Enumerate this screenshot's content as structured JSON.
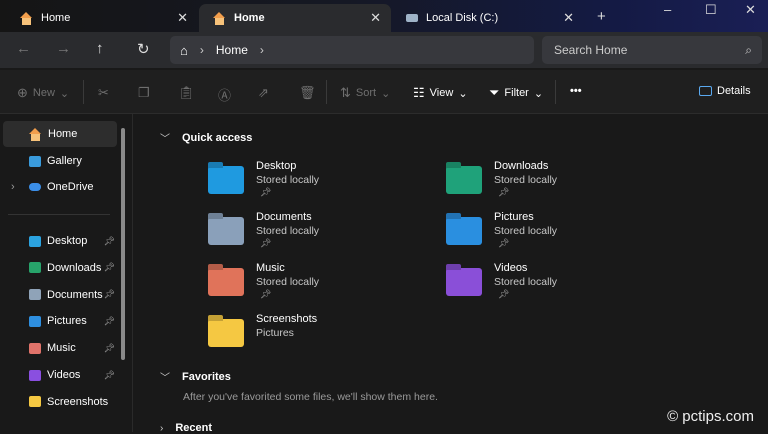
{
  "tabs": [
    {
      "label": "Home",
      "active": false
    },
    {
      "label": "Home",
      "active": true
    },
    {
      "label": "Local Disk (C:)",
      "active": false
    }
  ],
  "window_controls": {
    "new_tab": "+",
    "minimize": "–",
    "maximize": "☐",
    "close": "✕"
  },
  "address": {
    "segments": [
      "Home"
    ],
    "search_placeholder": "Search Home"
  },
  "toolbar": {
    "new": "New",
    "sort": "Sort",
    "view": "View",
    "filter": "Filter",
    "more": "•••",
    "details": "Details"
  },
  "sidebar": {
    "items": [
      {
        "label": "Home",
        "icon": "home-icon",
        "color": "#f29e4c",
        "selected": true
      },
      {
        "label": "Gallery",
        "icon": "gallery-icon",
        "color": "#3a9bdc"
      },
      {
        "label": "OneDrive",
        "icon": "cloud-icon",
        "color": "#3b8ee8",
        "expand": true
      }
    ],
    "pinned": [
      {
        "label": "Desktop",
        "color": "#2ba3e0"
      },
      {
        "label": "Downloads",
        "color": "#27a36a"
      },
      {
        "label": "Documents",
        "color": "#8fa3b8"
      },
      {
        "label": "Pictures",
        "color": "#2e8fe0"
      },
      {
        "label": "Music",
        "color": "#e0736a"
      },
      {
        "label": "Videos",
        "color": "#8a4fe0"
      },
      {
        "label": "Screenshots",
        "color": "#f5c842"
      }
    ]
  },
  "quick_access": {
    "title": "Quick access",
    "items": [
      {
        "name": "Desktop",
        "sub": "Stored locally",
        "pinned": true,
        "color": "#1f9ae0"
      },
      {
        "name": "Downloads",
        "sub": "Stored locally",
        "pinned": true,
        "color": "#1fa27a"
      },
      {
        "name": "Documents",
        "sub": "Stored locally",
        "pinned": true,
        "color": "#8aa0ba"
      },
      {
        "name": "Pictures",
        "sub": "Stored locally",
        "pinned": true,
        "color": "#2a8fe0"
      },
      {
        "name": "Music",
        "sub": "Stored locally",
        "pinned": true,
        "color": "#e0735a"
      },
      {
        "name": "Videos",
        "sub": "Stored locally",
        "pinned": true,
        "color": "#8a4fd8"
      },
      {
        "name": "Screenshots",
        "sub": "Pictures",
        "pinned": false,
        "color": "#f5c842"
      }
    ]
  },
  "favorites": {
    "title": "Favorites",
    "empty": "After you've favorited some files, we'll show them here."
  },
  "recent": {
    "title": "Recent"
  },
  "watermark": "© pctips.com"
}
